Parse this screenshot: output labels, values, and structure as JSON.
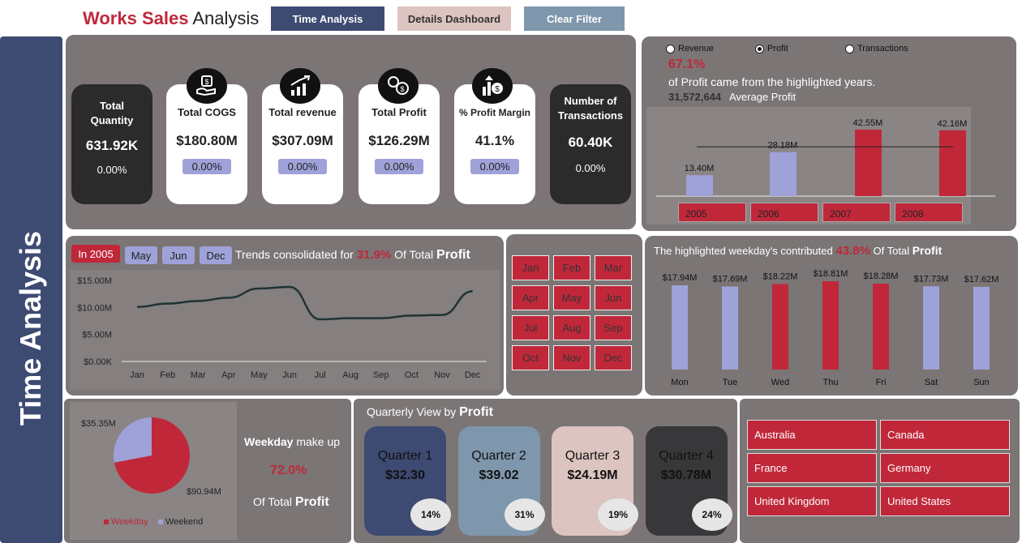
{
  "header": {
    "title_brand": "Works Sales",
    "title_rest": " Analysis",
    "buttons": [
      {
        "label": "Time Analysis",
        "bg": "#3d4a72",
        "fg": "#ffffff"
      },
      {
        "label": "Details Dashboard",
        "bg": "#dcc4c0",
        "fg": "#333333"
      },
      {
        "label": "Clear Filter",
        "bg": "#7f97ad",
        "fg": "#ffffff"
      }
    ]
  },
  "sidebar": {
    "label": "Time Analysis"
  },
  "kpis": [
    {
      "label": "Total Quantity",
      "value": "631.92K",
      "pct": "0.00%",
      "style": "dark"
    },
    {
      "label": "Total COGS",
      "value": "$180.80M",
      "pct": "0.00%",
      "style": "light",
      "icon": "money-hand-icon"
    },
    {
      "label": "Total revenue",
      "value": "$307.09M",
      "pct": "0.00%",
      "style": "light",
      "icon": "bar-growth-icon"
    },
    {
      "label": "Total Profit",
      "value": "$126.29M",
      "pct": "0.00%",
      "style": "light",
      "icon": "coins-icon"
    },
    {
      "label": "% Profit Margin",
      "value": "41.1%",
      "pct": "0.00%",
      "style": "light",
      "icon": "profit-margin-icon"
    },
    {
      "label": "Number of Transactions",
      "value": "60.40K",
      "pct": "0.00%",
      "style": "dark"
    }
  ],
  "year_panel": {
    "radios": [
      {
        "label": "Revenue",
        "selected": false
      },
      {
        "label": "Profit",
        "selected": true
      },
      {
        "label": "Transactions",
        "selected": false
      }
    ],
    "highlight_pct": "67.1%",
    "highlight_text": "of Profit came from the highlighted years.",
    "avg_value": "31,572,644",
    "avg_label": "Average Profit",
    "years": [
      "2005",
      "2006",
      "2007",
      "2008"
    ],
    "average_line": 31572644
  },
  "month_trend": {
    "chips": [
      {
        "label": "In 2005",
        "style": "red"
      },
      {
        "label": "May",
        "style": "blue"
      },
      {
        "label": "Jun",
        "style": "blue"
      },
      {
        "label": "Dec",
        "style": "blue"
      }
    ],
    "text_prefix": "Trends consolidated for",
    "pct": "31.9%",
    "text_mid": "Of Total",
    "text_bold": "Profit"
  },
  "month_buttons": [
    "Jan",
    "Feb",
    "Mar",
    "Apr",
    "May",
    "Jun",
    "Jul",
    "Aug",
    "Sep",
    "Oct",
    "Nov",
    "Dec"
  ],
  "weekday_panel": {
    "text_prefix": "The highlighted weekday's contributed",
    "pct": "43.8%",
    "text_mid": "Of Total",
    "text_bold": "Profit"
  },
  "pie_panel": {
    "bold": "Weekday",
    "rest": "make up",
    "pct": "72.0%",
    "footer_pre": "Of Total",
    "footer_bold": "Profit"
  },
  "quarters": {
    "title_pre": "Quarterly View by",
    "title_bold": "Profit",
    "items": [
      {
        "name": "Quarter 1",
        "value": "$32.30",
        "pct": "14%",
        "bg": "#3d4a72",
        "fg": "#111111"
      },
      {
        "name": "Quarter 2",
        "value": "$39.02",
        "pct": "31%",
        "bg": "#7f97ad",
        "fg": "#111111"
      },
      {
        "name": "Quarter 3",
        "value": "$24.19M",
        "pct": "19%",
        "bg": "#dcc4c0",
        "fg": "#111111"
      },
      {
        "name": "Quarter 4",
        "value": "$30.78M",
        "pct": "24%",
        "bg": "#38383b",
        "fg": "#111111"
      }
    ]
  },
  "countries": [
    "Australia",
    "Canada",
    "France",
    "Germany",
    "United Kingdom",
    "United States"
  ],
  "colors": {
    "accent_red": "#c0283a",
    "accent_blue": "#9fa2d8",
    "panel": "#7b7575",
    "navy": "#3d4a72"
  },
  "chart_data": [
    {
      "type": "bar",
      "id": "yearly_profit",
      "categories": [
        "2005",
        "2006",
        "2007",
        "2008"
      ],
      "values": [
        13.4,
        28.18,
        42.55,
        42.16
      ],
      "labels": [
        "13.40M",
        "28.18M",
        "42.55M",
        "42.16M"
      ],
      "highlighted": [
        false,
        false,
        true,
        true
      ],
      "reference_line": 31.57
    },
    {
      "type": "line",
      "id": "monthly_profit",
      "x": [
        "Jan",
        "Feb",
        "Mar",
        "Apr",
        "May",
        "Jun",
        "Jul",
        "Aug",
        "Sep",
        "Oct",
        "Nov",
        "Dec"
      ],
      "y": [
        10.1,
        10.7,
        11.2,
        11.8,
        13.5,
        13.8,
        7.8,
        8.0,
        8.0,
        8.5,
        8.6,
        13.0
      ],
      "yticks": [
        "$0.00K",
        "$5.00M",
        "$10.00M",
        "$15.00M"
      ],
      "ylim": [
        0,
        15
      ],
      "grid": false
    },
    {
      "type": "bar",
      "id": "weekday_profit",
      "categories": [
        "Mon",
        "Tue",
        "Wed",
        "Thu",
        "Fri",
        "Sat",
        "Sun"
      ],
      "values": [
        17.94,
        17.69,
        18.22,
        18.81,
        18.28,
        17.73,
        17.62
      ],
      "labels": [
        "$17.94M",
        "$17.69M",
        "$18.22M",
        "$18.81M",
        "$18.28M",
        "$17.73M",
        "$17.62M"
      ],
      "highlighted": [
        false,
        false,
        true,
        true,
        true,
        false,
        false
      ]
    },
    {
      "type": "pie",
      "id": "weekday_weekend",
      "categories": [
        "Weekday",
        "Weekend"
      ],
      "values": [
        90.94,
        35.35
      ],
      "labels": [
        "$90.94M",
        "$35.35M"
      ],
      "colors": [
        "#c0283a",
        "#9fa2d8"
      ],
      "legend": "bottom"
    }
  ]
}
